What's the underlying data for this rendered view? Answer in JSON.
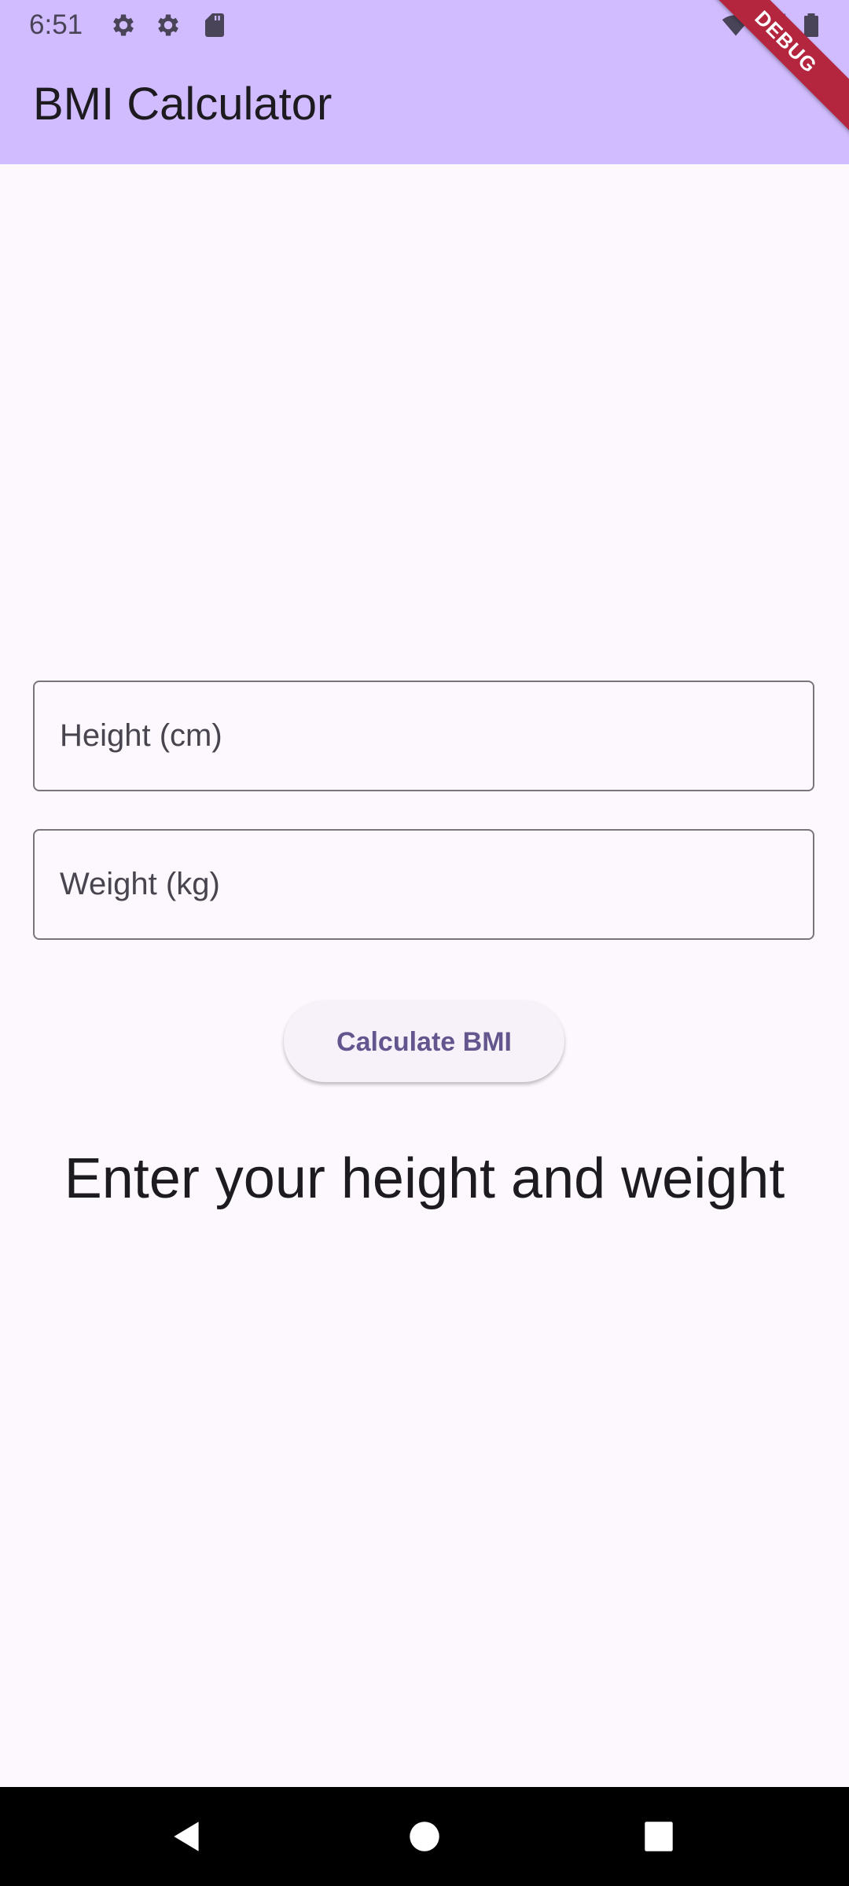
{
  "status_bar": {
    "time": "6:51",
    "icons": [
      "settings-icon",
      "settings-icon",
      "sd-card-icon",
      "wifi-icon",
      "signal-icon",
      "battery-icon"
    ]
  },
  "app_bar": {
    "title": "BMI Calculator",
    "debug_label": "DEBUG"
  },
  "form": {
    "height_placeholder": "Height (cm)",
    "height_value": "",
    "weight_placeholder": "Weight (kg)",
    "weight_value": "",
    "button_label": "Calculate BMI"
  },
  "result": {
    "text": "Enter your height and weight"
  },
  "nav_bar": {
    "icons": [
      "back-icon",
      "home-icon",
      "recents-icon"
    ]
  },
  "colors": {
    "app_bar": "#d0bcff",
    "background": "#fdf7fe",
    "accent": "#65558f",
    "debug_ribbon": "#b3263e"
  }
}
